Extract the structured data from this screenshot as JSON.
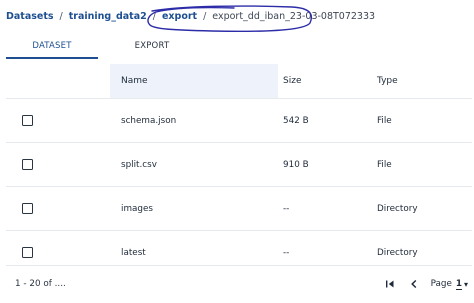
{
  "breadcrumb": {
    "items": [
      "Datasets",
      "training_data2",
      "export"
    ],
    "separator": "/",
    "current": "export_dd_iban_23-03-08T072333"
  },
  "tabs": [
    {
      "label": "DATASET",
      "active": true
    },
    {
      "label": "EXPORT",
      "active": false
    }
  ],
  "table": {
    "columns": [
      "Name",
      "Size",
      "Type"
    ],
    "rows": [
      {
        "name": "schema.json",
        "size": "542 B",
        "type": "File"
      },
      {
        "name": "split.csv",
        "size": "910 B",
        "type": "File"
      },
      {
        "name": "images",
        "size": "--",
        "type": "Directory"
      },
      {
        "name": "latest",
        "size": "--",
        "type": "Directory"
      }
    ]
  },
  "footer": {
    "range": "1 - 20 of ....",
    "page_label": "Page",
    "page_number": "1",
    "icons": [
      "first-page-icon",
      "prev-page-icon",
      "chevron-down-icon"
    ]
  },
  "colors": {
    "accent": "#1d4f91",
    "header_bg": "#eef3fb",
    "annotation_ink": "#2c2ca8"
  }
}
